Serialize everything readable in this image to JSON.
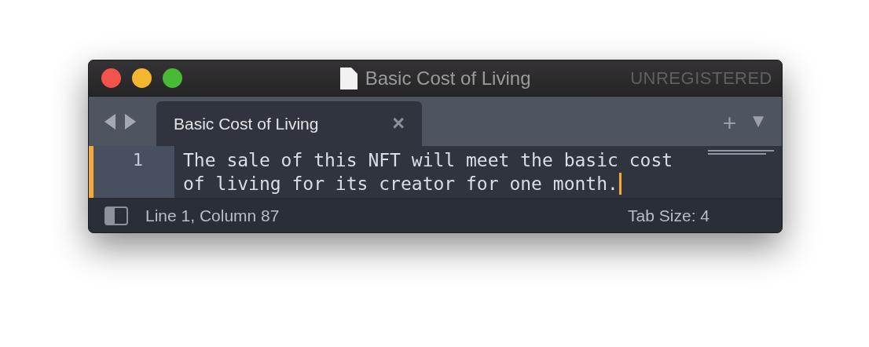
{
  "window": {
    "title": "Basic Cost of Living",
    "badge": "UNREGISTERED"
  },
  "tabs": [
    {
      "label": "Basic Cost of Living",
      "close": "×",
      "selected": true
    }
  ],
  "tab_controls": {
    "new": "+",
    "menu": "▼"
  },
  "editor": {
    "lines": [
      {
        "number": "1",
        "text_lines": [
          "The sale of this NFT will meet the basic cost",
          "of living for its creator for one month."
        ],
        "current": true
      }
    ]
  },
  "status_bar": {
    "position": "Line 1, Column 87",
    "tab_size": "Tab Size: 4"
  }
}
